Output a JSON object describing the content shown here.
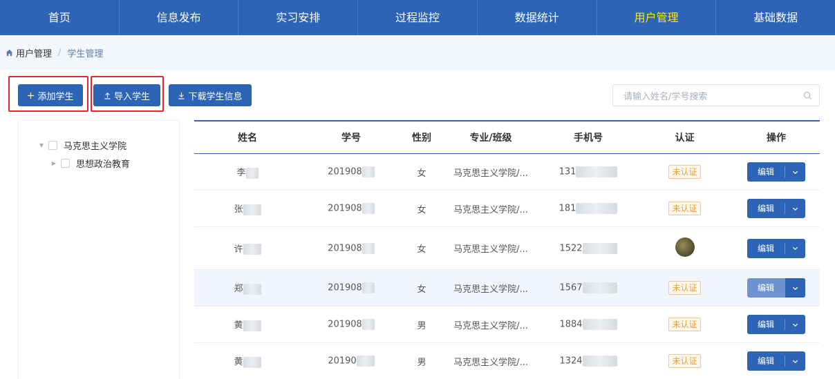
{
  "nav": {
    "items": [
      {
        "label": "首页"
      },
      {
        "label": "信息发布"
      },
      {
        "label": "实习安排"
      },
      {
        "label": "过程监控"
      },
      {
        "label": "数据统计"
      },
      {
        "label": "用户管理",
        "active": true
      },
      {
        "label": "基础数据"
      }
    ]
  },
  "breadcrumb": {
    "parent": "用户管理",
    "separator": "/",
    "current": "学生管理"
  },
  "toolbar": {
    "add_label": "添加学生",
    "import_label": "导入学生",
    "download_label": "下载学生信息"
  },
  "search": {
    "placeholder": "请输入姓名/学号搜索"
  },
  "tree": {
    "nodes": [
      {
        "label": "马克思主义学院",
        "expanded": true
      },
      {
        "label": "思想政治教育",
        "expanded": false
      }
    ]
  },
  "table": {
    "headers": [
      "姓名",
      "学号",
      "性别",
      "专业/班级",
      "手机号",
      "认证",
      "操作"
    ],
    "rows": [
      {
        "name": "李",
        "id": "201908",
        "sex": "女",
        "major": "马克思主义学院/...",
        "phone": "131",
        "auth": "未认证",
        "op": "编辑"
      },
      {
        "name": "张",
        "id": "201908",
        "sex": "女",
        "major": "马克思主义学院/...",
        "phone": "181",
        "auth": "未认证",
        "op": "编辑"
      },
      {
        "name": "许",
        "id": "201908",
        "sex": "女",
        "major": "马克思主义学院/...",
        "phone": "1522",
        "auth": "",
        "op": "编辑"
      },
      {
        "name": "郑",
        "id": "201908",
        "sex": "女",
        "major": "马克思主义学院/...",
        "phone": "1567",
        "auth": "未认证",
        "op": "编辑"
      },
      {
        "name": "黄",
        "id": "201908",
        "sex": "男",
        "major": "马克思主义学院/...",
        "phone": "1884",
        "auth": "未认证",
        "op": "编辑"
      },
      {
        "name": "黄",
        "id": "20190",
        "sex": "男",
        "major": "马克思主义学院/...",
        "phone": "1324",
        "auth": "未认证",
        "op": "编辑"
      }
    ]
  },
  "colors": {
    "primary": "#2d64b5",
    "active_nav": "#ffe11a",
    "highlight": "#e8232b",
    "badge": "#e6a23c"
  }
}
